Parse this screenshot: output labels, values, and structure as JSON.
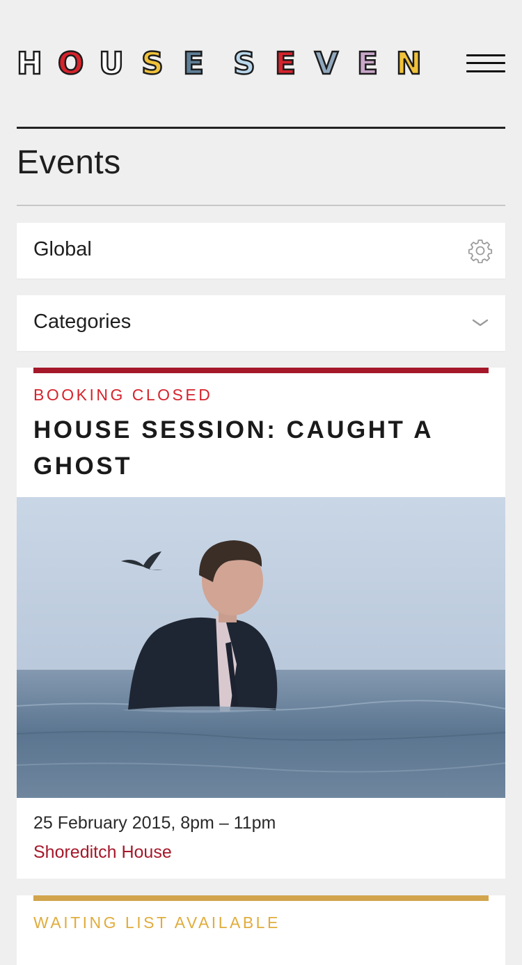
{
  "header": {
    "logo_letters": [
      {
        "char": "H",
        "accent": ""
      },
      {
        "char": "O",
        "accent": "#d6232c"
      },
      {
        "char": "U",
        "accent": ""
      },
      {
        "char": "S",
        "accent": "#f0c23b"
      },
      {
        "char": "E",
        "accent": "#5f7f97"
      },
      {
        "char": "S",
        "accent": "#b9d7ec"
      },
      {
        "char": "E",
        "accent": "#d6232c"
      },
      {
        "char": "V",
        "accent": "#90a8bd"
      },
      {
        "char": "E",
        "accent": "#c9a6c9"
      },
      {
        "char": "N",
        "accent": "#f0c23b"
      }
    ],
    "menu_icon": "hamburger-menu-icon"
  },
  "page": {
    "title": "Events"
  },
  "filters": [
    {
      "label": "Global",
      "icon": "gear-icon"
    },
    {
      "label": "Categories",
      "icon": "chevron-down-icon"
    }
  ],
  "events": [
    {
      "status": "BOOKING CLOSED",
      "status_color": "#d6232c",
      "bar_color": "#a5182a",
      "title": "HOUSE SESSION: CAUGHT A GHOST",
      "date": "25 February 2015, 8pm – 11pm",
      "venue": "Shoreditch House"
    },
    {
      "status": "WAITING LIST AVAILABLE",
      "status_color": "#e0ac3c",
      "bar_color": "#d2a44c"
    }
  ],
  "colors": {
    "background": "#efefef",
    "card": "#ffffff",
    "accent_red": "#a5182a",
    "accent_gold": "#d2a44c"
  }
}
